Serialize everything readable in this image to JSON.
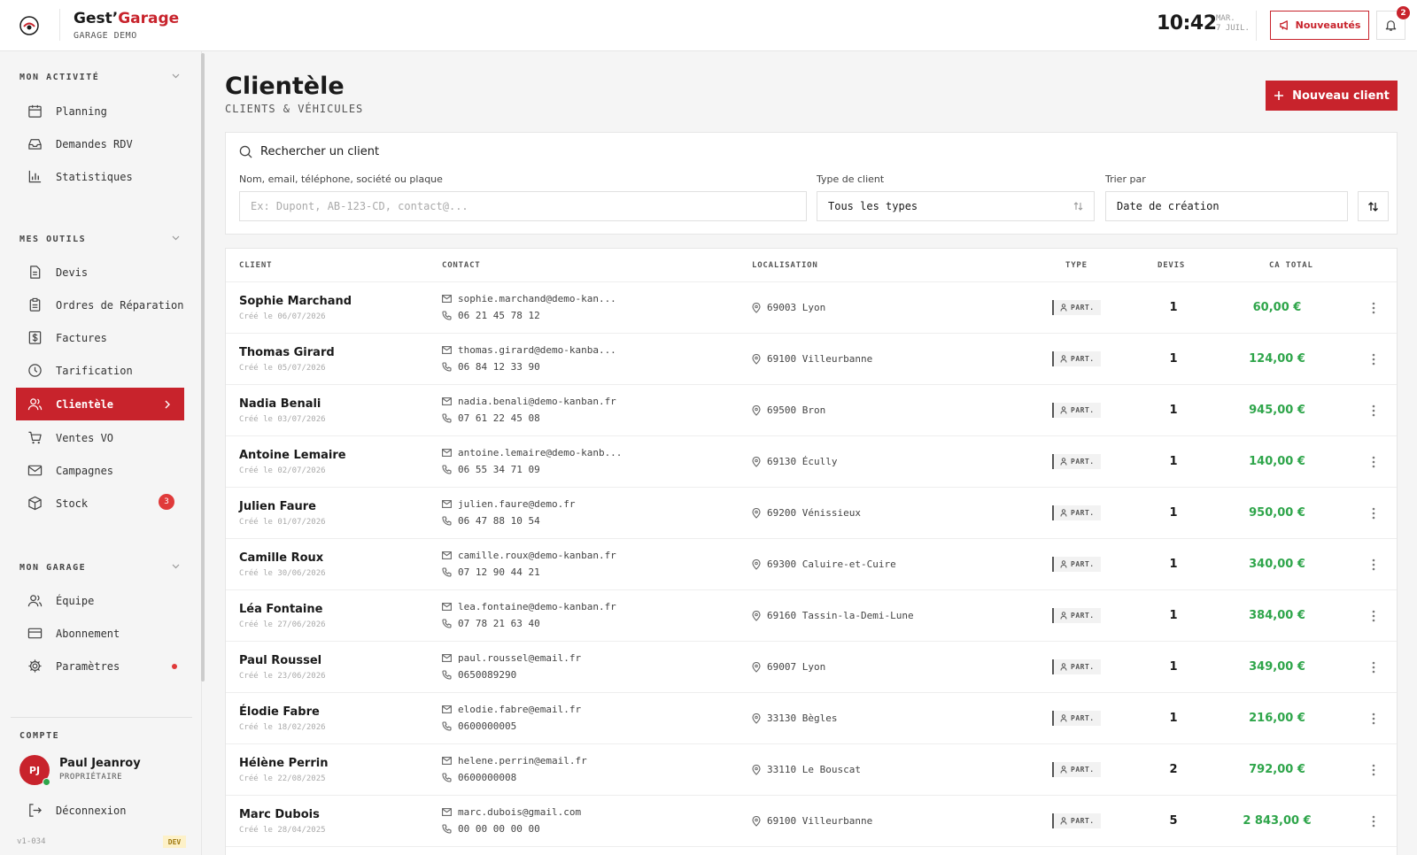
{
  "header": {
    "brand_name_a": "Gest’",
    "brand_name_b": "Garage",
    "brand_sub": "GARAGE DEMO",
    "time": "10:42",
    "date_day": "MAR.",
    "date_month": "7 JUIL.",
    "news_label": "Nouveautés",
    "notif_count": "2"
  },
  "sidebar": {
    "sections": [
      {
        "title": "MON ACTIVITÉ"
      },
      {
        "title": "MES OUTILS"
      },
      {
        "title": "MON GARAGE"
      }
    ],
    "activity_items": [
      {
        "label": "Planning",
        "icon": "calendar-icon"
      },
      {
        "label": "Demandes RDV",
        "icon": "inbox-icon"
      },
      {
        "label": "Statistiques",
        "icon": "bar-chart-icon"
      }
    ],
    "tools_items": [
      {
        "label": "Devis",
        "icon": "document-icon"
      },
      {
        "label": "Ordres de Réparation",
        "icon": "clipboard-icon"
      },
      {
        "label": "Factures",
        "icon": "dollar-icon"
      },
      {
        "label": "Tarification",
        "icon": "clock-icon"
      },
      {
        "label": "Clientèle",
        "icon": "users-icon",
        "active": true
      },
      {
        "label": "Ventes VO",
        "icon": "cart-icon"
      },
      {
        "label": "Campagnes",
        "icon": "mail-icon"
      },
      {
        "label": "Stock",
        "icon": "box-icon",
        "badge": "3"
      }
    ],
    "garage_items": [
      {
        "label": "Équipe",
        "icon": "team-icon"
      },
      {
        "label": "Abonnement",
        "icon": "card-icon"
      },
      {
        "label": "Paramètres",
        "icon": "gear-icon",
        "dot": true
      }
    ],
    "account_title": "COMPTE",
    "user_initials": "PJ",
    "user_name": "Paul Jeanroy",
    "user_role": "PROPRIÉTAIRE",
    "logout_label": "Déconnexion",
    "version": "v1-034",
    "env_badge": "DEV"
  },
  "page": {
    "title": "Clientèle",
    "subtitle": "CLIENTS & VÉHICULES",
    "new_client_label": "Nouveau client"
  },
  "filters": {
    "title": "Rechercher un client",
    "search_label": "Nom, email, téléphone, société ou plaque",
    "search_placeholder": "Ex: Dupont, AB-123-CD, contact@...",
    "type_label": "Type de client",
    "type_value": "Tous les types",
    "sort_label": "Trier par",
    "sort_value": "Date de création"
  },
  "table": {
    "headers": {
      "client": "CLIENT",
      "contact": "CONTACT",
      "location": "LOCALISATION",
      "type": "TYPE",
      "devis": "DEVIS",
      "ca": "CA TOTAL"
    },
    "rows": [
      {
        "name": "Sophie Marchand",
        "created": "Créé le 06/07/2026",
        "email": "sophie.marchand@demo-kan...",
        "phone": "06 21 45 78 12",
        "location": "69003 Lyon",
        "type": "PART.",
        "devis": "1",
        "ca": "60,00 €"
      },
      {
        "name": "Thomas Girard",
        "created": "Créé le 05/07/2026",
        "email": "thomas.girard@demo-kanba...",
        "phone": "06 84 12 33 90",
        "location": "69100 Villeurbanne",
        "type": "PART.",
        "devis": "1",
        "ca": "124,00 €"
      },
      {
        "name": "Nadia Benali",
        "created": "Créé le 03/07/2026",
        "email": "nadia.benali@demo-kanban.fr",
        "phone": "07 61 22 45 08",
        "location": "69500 Bron",
        "type": "PART.",
        "devis": "1",
        "ca": "945,00 €"
      },
      {
        "name": "Antoine Lemaire",
        "created": "Créé le 02/07/2026",
        "email": "antoine.lemaire@demo-kanb...",
        "phone": "06 55 34 71 09",
        "location": "69130 Écully",
        "type": "PART.",
        "devis": "1",
        "ca": "140,00 €"
      },
      {
        "name": "Julien Faure",
        "created": "Créé le 01/07/2026",
        "email": "julien.faure@demo.fr",
        "phone": "06 47 88 10 54",
        "location": "69200 Vénissieux",
        "type": "PART.",
        "devis": "1",
        "ca": "950,00 €"
      },
      {
        "name": "Camille Roux",
        "created": "Créé le 30/06/2026",
        "email": "camille.roux@demo-kanban.fr",
        "phone": "07 12 90 44 21",
        "location": "69300 Caluire-et-Cuire",
        "type": "PART.",
        "devis": "1",
        "ca": "340,00 €"
      },
      {
        "name": "Léa Fontaine",
        "created": "Créé le 27/06/2026",
        "email": "lea.fontaine@demo-kanban.fr",
        "phone": "07 78 21 63 40",
        "location": "69160 Tassin-la-Demi-Lune",
        "type": "PART.",
        "devis": "1",
        "ca": "384,00 €"
      },
      {
        "name": "Paul Roussel",
        "created": "Créé le 23/06/2026",
        "email": "paul.roussel@email.fr",
        "phone": "0650089290",
        "location": "69007 Lyon",
        "type": "PART.",
        "devis": "1",
        "ca": "349,00 €"
      },
      {
        "name": "Élodie Fabre",
        "created": "Créé le 18/02/2026",
        "email": "elodie.fabre@email.fr",
        "phone": "0600000005",
        "location": "33130 Bègles",
        "type": "PART.",
        "devis": "1",
        "ca": "216,00 €"
      },
      {
        "name": "Hélène Perrin",
        "created": "Créé le 22/08/2025",
        "email": "helene.perrin@email.fr",
        "phone": "0600000008",
        "location": "33110 Le Bouscat",
        "type": "PART.",
        "devis": "2",
        "ca": "792,00 €"
      },
      {
        "name": "Marc Dubois",
        "created": "Créé le 28/04/2025",
        "email": "marc.dubois@gmail.com",
        "phone": "00 00 00 00 00",
        "location": "69100 Villeurbanne",
        "type": "PART.",
        "devis": "5",
        "ca": "2 843,00 €"
      }
    ]
  },
  "colors": {
    "accent": "#c8232c",
    "amount": "#2ea54a",
    "online": "#2ea54a"
  }
}
